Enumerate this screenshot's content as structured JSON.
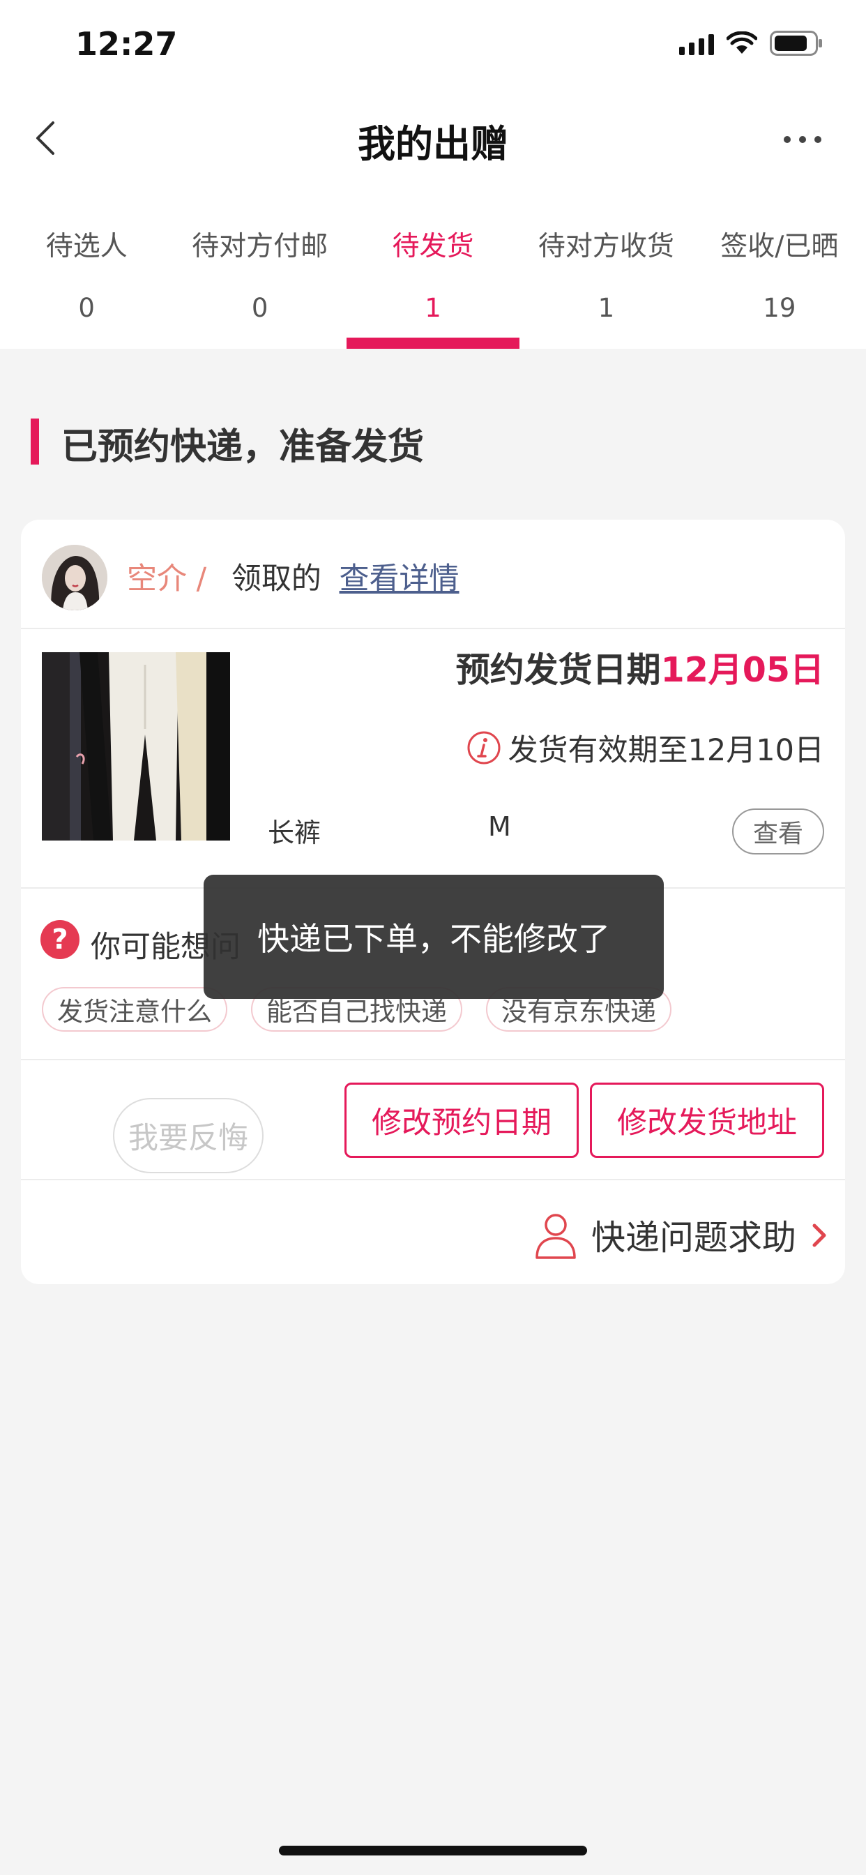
{
  "status_bar": {
    "time": "12:27"
  },
  "header": {
    "title": "我的出赠"
  },
  "tabs": [
    {
      "label": "待选人",
      "count": "0"
    },
    {
      "label": "待对方付邮",
      "count": "0"
    },
    {
      "label": "待发货",
      "count": "1",
      "active": true
    },
    {
      "label": "待对方收货",
      "count": "1"
    },
    {
      "label": "签收/已晒",
      "count": "19"
    }
  ],
  "section": {
    "title": "已预约快递，准备发货"
  },
  "card": {
    "user_name": "空介",
    "slash": "/",
    "action": "领取的",
    "detail_link": "查看详情",
    "schedule_label": "预约发货日期",
    "schedule_date": "12月05日",
    "validity": "发货有效期至12月10日",
    "item_name": "长裤",
    "item_size": "M",
    "view_label": "查看",
    "faq_title": "你可能想问",
    "faq_chips": [
      "发货注意什么",
      "能否自己找快递",
      "没有京东快递"
    ],
    "regret_label": "我要反悔",
    "edit_date_label": "修改预约日期",
    "edit_address_label": "修改发货地址",
    "help_label": "快递问题求助"
  },
  "toast": {
    "text": "快递已下单，不能修改了"
  },
  "colors": {
    "accent": "#e5195a",
    "user_name": "#e8877a",
    "link": "#4d5f8d"
  }
}
